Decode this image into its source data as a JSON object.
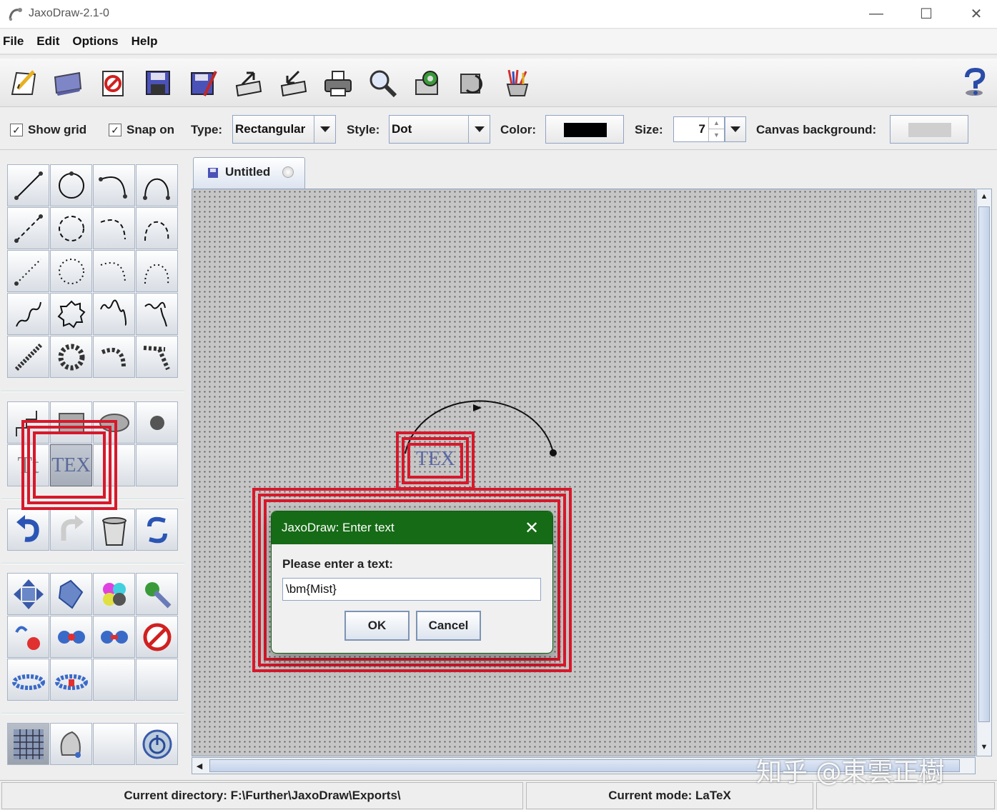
{
  "window": {
    "title": "JaxoDraw-2.1-0",
    "minimize": "—",
    "maximize": "☐",
    "close": "✕"
  },
  "menu": [
    "File",
    "Edit",
    "Options",
    "Help"
  ],
  "toolbar": {
    "buttons": [
      "new-file-icon",
      "open-folder-icon",
      "clear-icon",
      "save-icon",
      "save-as-icon",
      "export-icon",
      "import-icon",
      "print-icon",
      "preview-icon",
      "preferences-icon",
      "refresh-icon",
      "latex-tools-icon",
      "help-icon"
    ]
  },
  "options": {
    "show_grid_label": "Show grid",
    "show_grid_checked": "✓",
    "snap_on_label": "Snap on",
    "snap_on_checked": "✓",
    "type_label": "Type:",
    "type_value": "Rectangular",
    "style_label": "Style:",
    "style_value": "Dot",
    "color_label": "Color:",
    "color_value": "#000000",
    "size_label": "Size:",
    "size_value": "7",
    "canvas_bg_label": "Canvas background:",
    "canvas_bg_value": "#c6c6c6"
  },
  "tab": {
    "label": "Untitled"
  },
  "dialog": {
    "title": "JaxoDraw: Enter text",
    "close": "✕",
    "prompt": "Please enter a text:",
    "input_value": "\\bm{Mist}",
    "ok_label": "OK",
    "cancel_label": "Cancel"
  },
  "canvas_objects": {
    "latex_label": "TEX"
  },
  "palette": {
    "tex_tool_label": "TEX",
    "text_tool_label": "Tt"
  },
  "statusbar": {
    "directory": "Current directory: F:\\Further\\JaxoDraw\\Exports\\",
    "mode": "Current mode: LaTeX"
  },
  "watermark": "知乎 @東雲正樹",
  "colors": {
    "dialog_title_bg": "#166b16",
    "highlight": "#d8182a",
    "canvas_bg": "#c6c6c6"
  }
}
